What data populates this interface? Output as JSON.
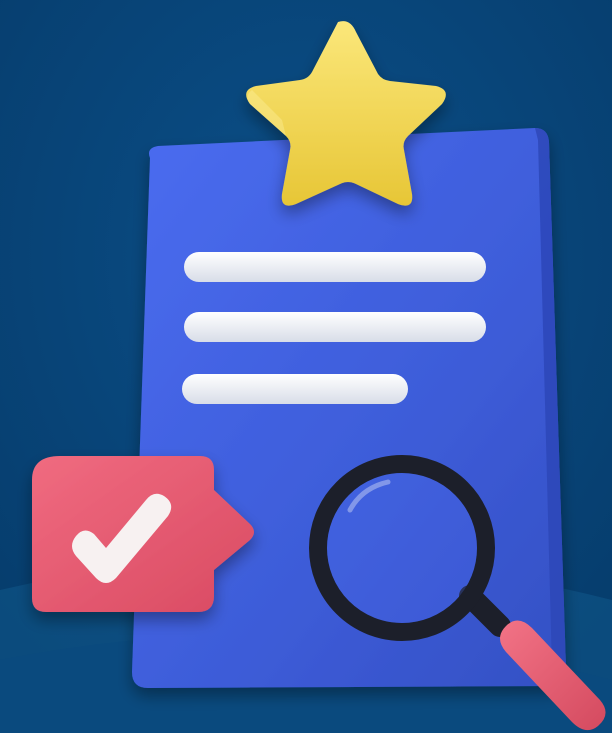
{
  "scene": {
    "subject": "review-document-illustration",
    "palette": {
      "background": "#074579",
      "background_arc": "#18608f",
      "clipboard": "#3f5fdc",
      "clipboard_shadow": "#2c46b6",
      "text_lines": "#eef1f7",
      "star": "#f3d94f",
      "badge": "#ec5e74",
      "checkmark": "#f7f1f1",
      "magnifier_ring": "#1c1f2a",
      "magnifier_handle": "#e85f72"
    },
    "icons": {
      "clipboard": "clipboard-icon",
      "star": "star-icon",
      "badge": "checkmark-badge-icon",
      "magnifier": "magnifying-glass-icon"
    },
    "content": {
      "text_line_count": 3,
      "rating_stars": 1,
      "approved": true
    }
  }
}
